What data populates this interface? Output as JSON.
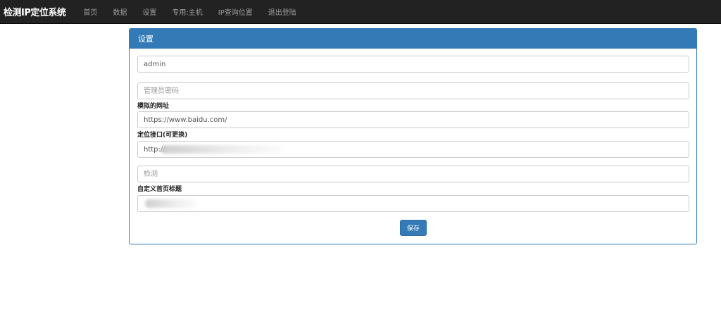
{
  "navbar": {
    "brand": "检测IP定位系统",
    "items": [
      {
        "label": "首页"
      },
      {
        "label": "数据"
      },
      {
        "label": "设置"
      },
      {
        "label": "专用:主机"
      },
      {
        "label": "IP查询位置"
      },
      {
        "label": "退出登陆"
      }
    ]
  },
  "panel": {
    "title": "设置",
    "fields": {
      "username": {
        "value": "admin",
        "placeholder": ""
      },
      "password": {
        "value": "",
        "placeholder": "管理员密码"
      },
      "mock_url_label": "模拟的网址",
      "mock_url": {
        "value": "https://www.baidu.com/",
        "placeholder": ""
      },
      "locate_api_label": "定位接口(可更换)",
      "locate_api": {
        "value": "http://",
        "placeholder": ""
      },
      "detect": {
        "value": "",
        "placeholder": "检测"
      },
      "home_title_label": "自定义首页标题",
      "home_title": {
        "value": "",
        "placeholder": ""
      }
    },
    "save_label": "保存"
  }
}
